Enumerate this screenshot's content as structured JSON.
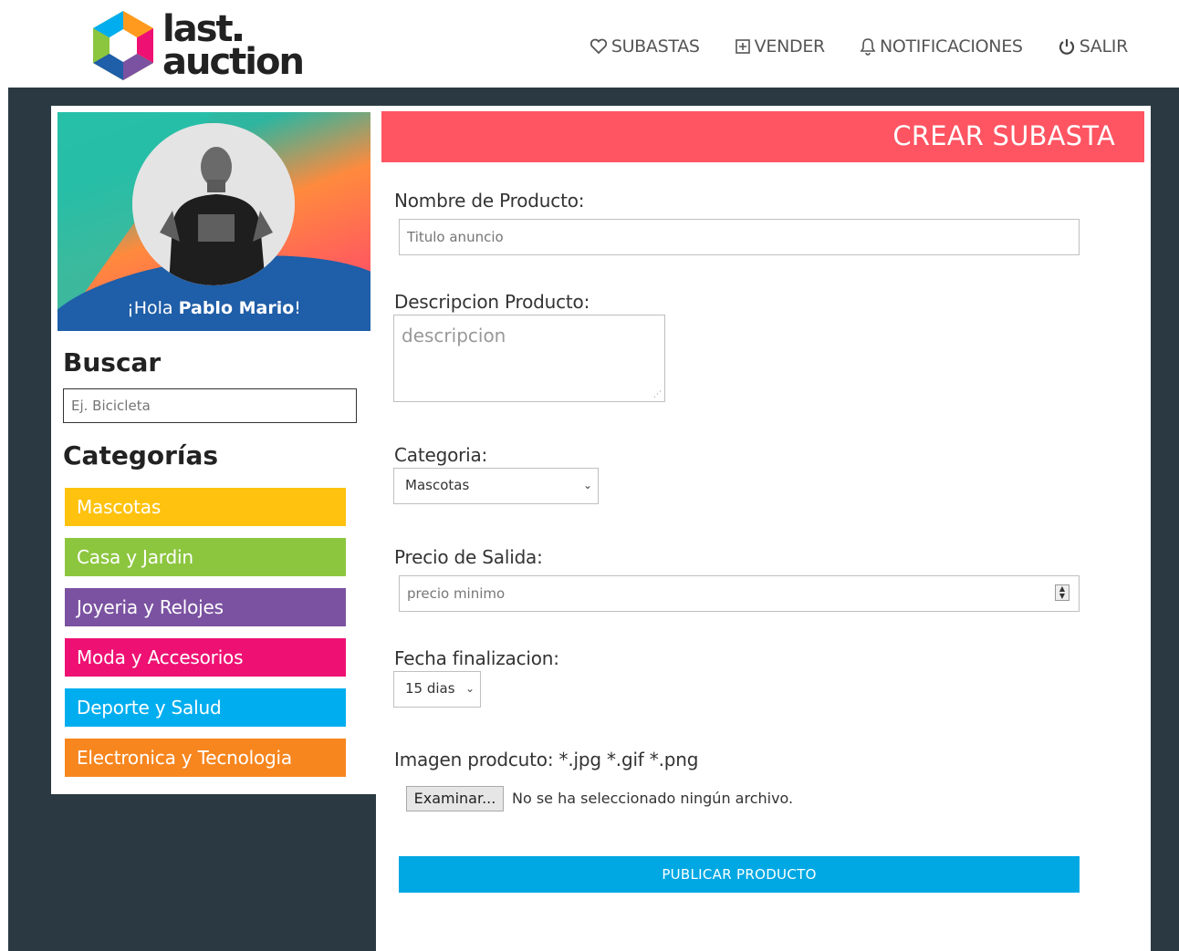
{
  "brand": {
    "line1": "last",
    "line2": "auction"
  },
  "nav": [
    {
      "label": "SUBASTAS",
      "icon": "heart-icon"
    },
    {
      "label": "VENDER",
      "icon": "plus-square-icon"
    },
    {
      "label": "NOTIFICACIONES",
      "icon": "bell-icon"
    },
    {
      "label": "SALIR",
      "icon": "power-icon"
    }
  ],
  "profile": {
    "greeting": "¡Hola ",
    "name": "Pablo Mario",
    "suffix": "!"
  },
  "search": {
    "title": "Buscar",
    "placeholder": "Ej. Bicicleta"
  },
  "categories": {
    "title": "Categorías",
    "items": [
      {
        "label": "Mascotas",
        "color": "#ffc20e"
      },
      {
        "label": "Casa y Jardin",
        "color": "#8cc63f"
      },
      {
        "label": "Joyeria y Relojes",
        "color": "#7b52a1"
      },
      {
        "label": "Moda y Accesorios",
        "color": "#ee1173"
      },
      {
        "label": "Deporte y Salud",
        "color": "#00aeef"
      },
      {
        "label": "Electronica y Tecnologia",
        "color": "#f7861f"
      }
    ]
  },
  "form": {
    "title": "CREAR SUBASTA",
    "name_label": "Nombre de Producto:",
    "name_placeholder": "Titulo anuncio",
    "desc_label": "Descripcion Producto:",
    "desc_placeholder": "descripcion",
    "category_label": "Categoria:",
    "category_value": "Mascotas",
    "price_label": "Precio de Salida:",
    "price_placeholder": "precio minimo",
    "end_label": "Fecha finalizacion:",
    "end_value": "15 dias",
    "image_label": "Imagen prodcuto: *.jpg *.gif *.png",
    "file_button": "Examinar...",
    "file_status": "No se ha seleccionado ningún archivo.",
    "publish_label": "PUBLICAR PRODUCTO"
  },
  "colors": {
    "title_bar": "#ff5462",
    "publish": "#00a8e3",
    "band": "#2b3a42"
  }
}
